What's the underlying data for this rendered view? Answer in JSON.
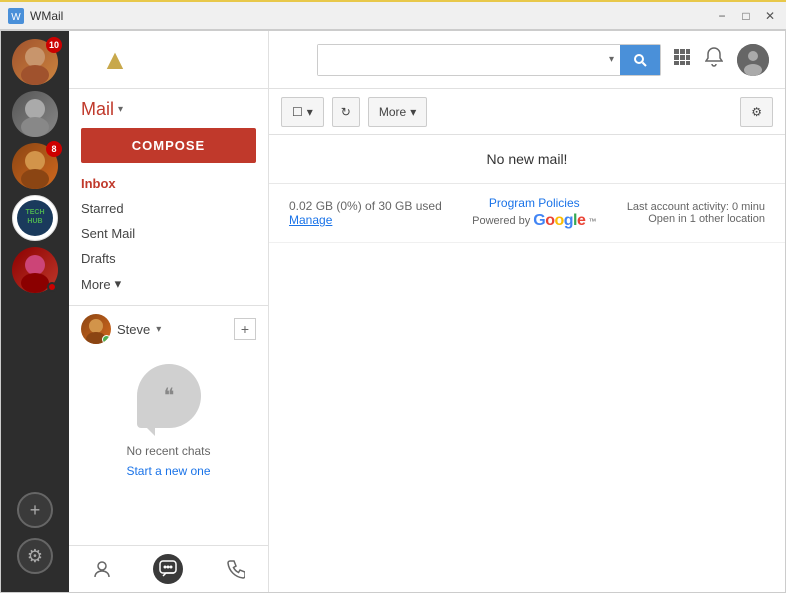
{
  "titlebar": {
    "title": "WMail",
    "minimize_label": "−",
    "maximize_label": "□",
    "close_label": "✕"
  },
  "sidebar": {
    "avatars": [
      {
        "id": "av1",
        "badge": "10",
        "class": "av1"
      },
      {
        "id": "av2",
        "badge": null,
        "class": "av2"
      },
      {
        "id": "av3",
        "badge": "8",
        "class": "av3"
      },
      {
        "id": "av4",
        "badge": null,
        "class": "av4"
      },
      {
        "id": "av5",
        "badge": null,
        "class": "av5",
        "dot": true
      }
    ],
    "add_label": "+",
    "settings_label": "⚙"
  },
  "panel": {
    "mail_title": "Mail",
    "compose_label": "COMPOSE",
    "nav": [
      {
        "label": "Inbox",
        "active": true
      },
      {
        "label": "Starred",
        "active": false
      },
      {
        "label": "Sent Mail",
        "active": false
      },
      {
        "label": "Drafts",
        "active": false
      },
      {
        "label": "More",
        "active": false,
        "has_arrow": true
      }
    ],
    "chat": {
      "username": "Steve",
      "add_label": "+",
      "online": true
    },
    "no_chats_text": "No recent chats",
    "start_new_label": "Start a new one",
    "bottom_icons": [
      {
        "label": "👤",
        "name": "contacts-icon",
        "active": false
      },
      {
        "label": "💬",
        "name": "chat-icon",
        "active": true
      },
      {
        "label": "📞",
        "name": "phone-icon",
        "active": false
      }
    ]
  },
  "header": {
    "search_placeholder": "",
    "search_btn_label": "🔍",
    "grid_icon": "⊞",
    "bell_icon": "🔔"
  },
  "toolbar": {
    "select_label": "□",
    "refresh_label": "↻",
    "more_label": "More",
    "gear_label": "⚙"
  },
  "mail": {
    "no_new_mail": "No new mail!",
    "storage_text": "0.02 GB (0%) of 30 GB used",
    "manage_label": "Manage",
    "program_policies_label": "Program Policies",
    "powered_by_label": "Powered by",
    "google_text": "Google",
    "activity_text": "Last account activity: 0 minu",
    "open_in_label": "Open in 1 other location"
  }
}
